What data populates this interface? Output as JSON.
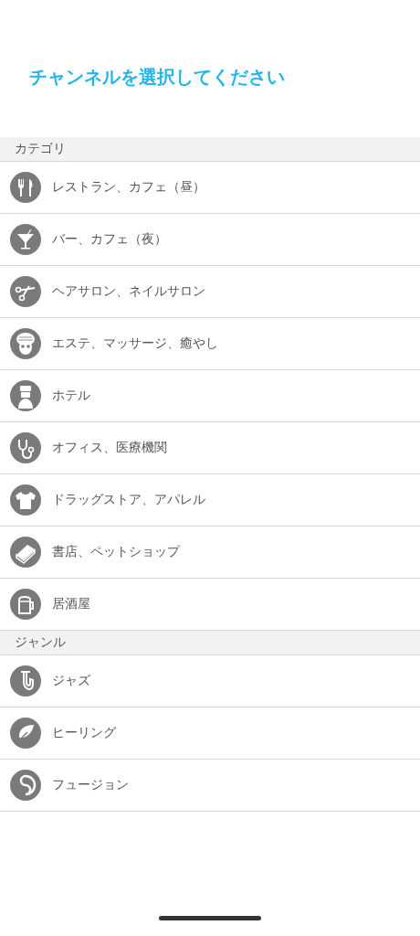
{
  "title": "チャンネルを選択してください",
  "sections": [
    {
      "header": "カテゴリ",
      "items": [
        {
          "label": "レストラン、カフェ（昼）"
        },
        {
          "label": "バー、カフェ（夜）"
        },
        {
          "label": "ヘアサロン、ネイルサロン"
        },
        {
          "label": "エステ、マッサージ、癒やし"
        },
        {
          "label": "ホテル"
        },
        {
          "label": "オフィス、医療機関"
        },
        {
          "label": "ドラッグストア、アパレル"
        },
        {
          "label": "書店、ペットショップ"
        },
        {
          "label": "居酒屋"
        }
      ]
    },
    {
      "header": "ジャンル",
      "items": [
        {
          "label": "ジャズ"
        },
        {
          "label": "ヒーリング"
        },
        {
          "label": "フュージョン"
        }
      ]
    }
  ]
}
